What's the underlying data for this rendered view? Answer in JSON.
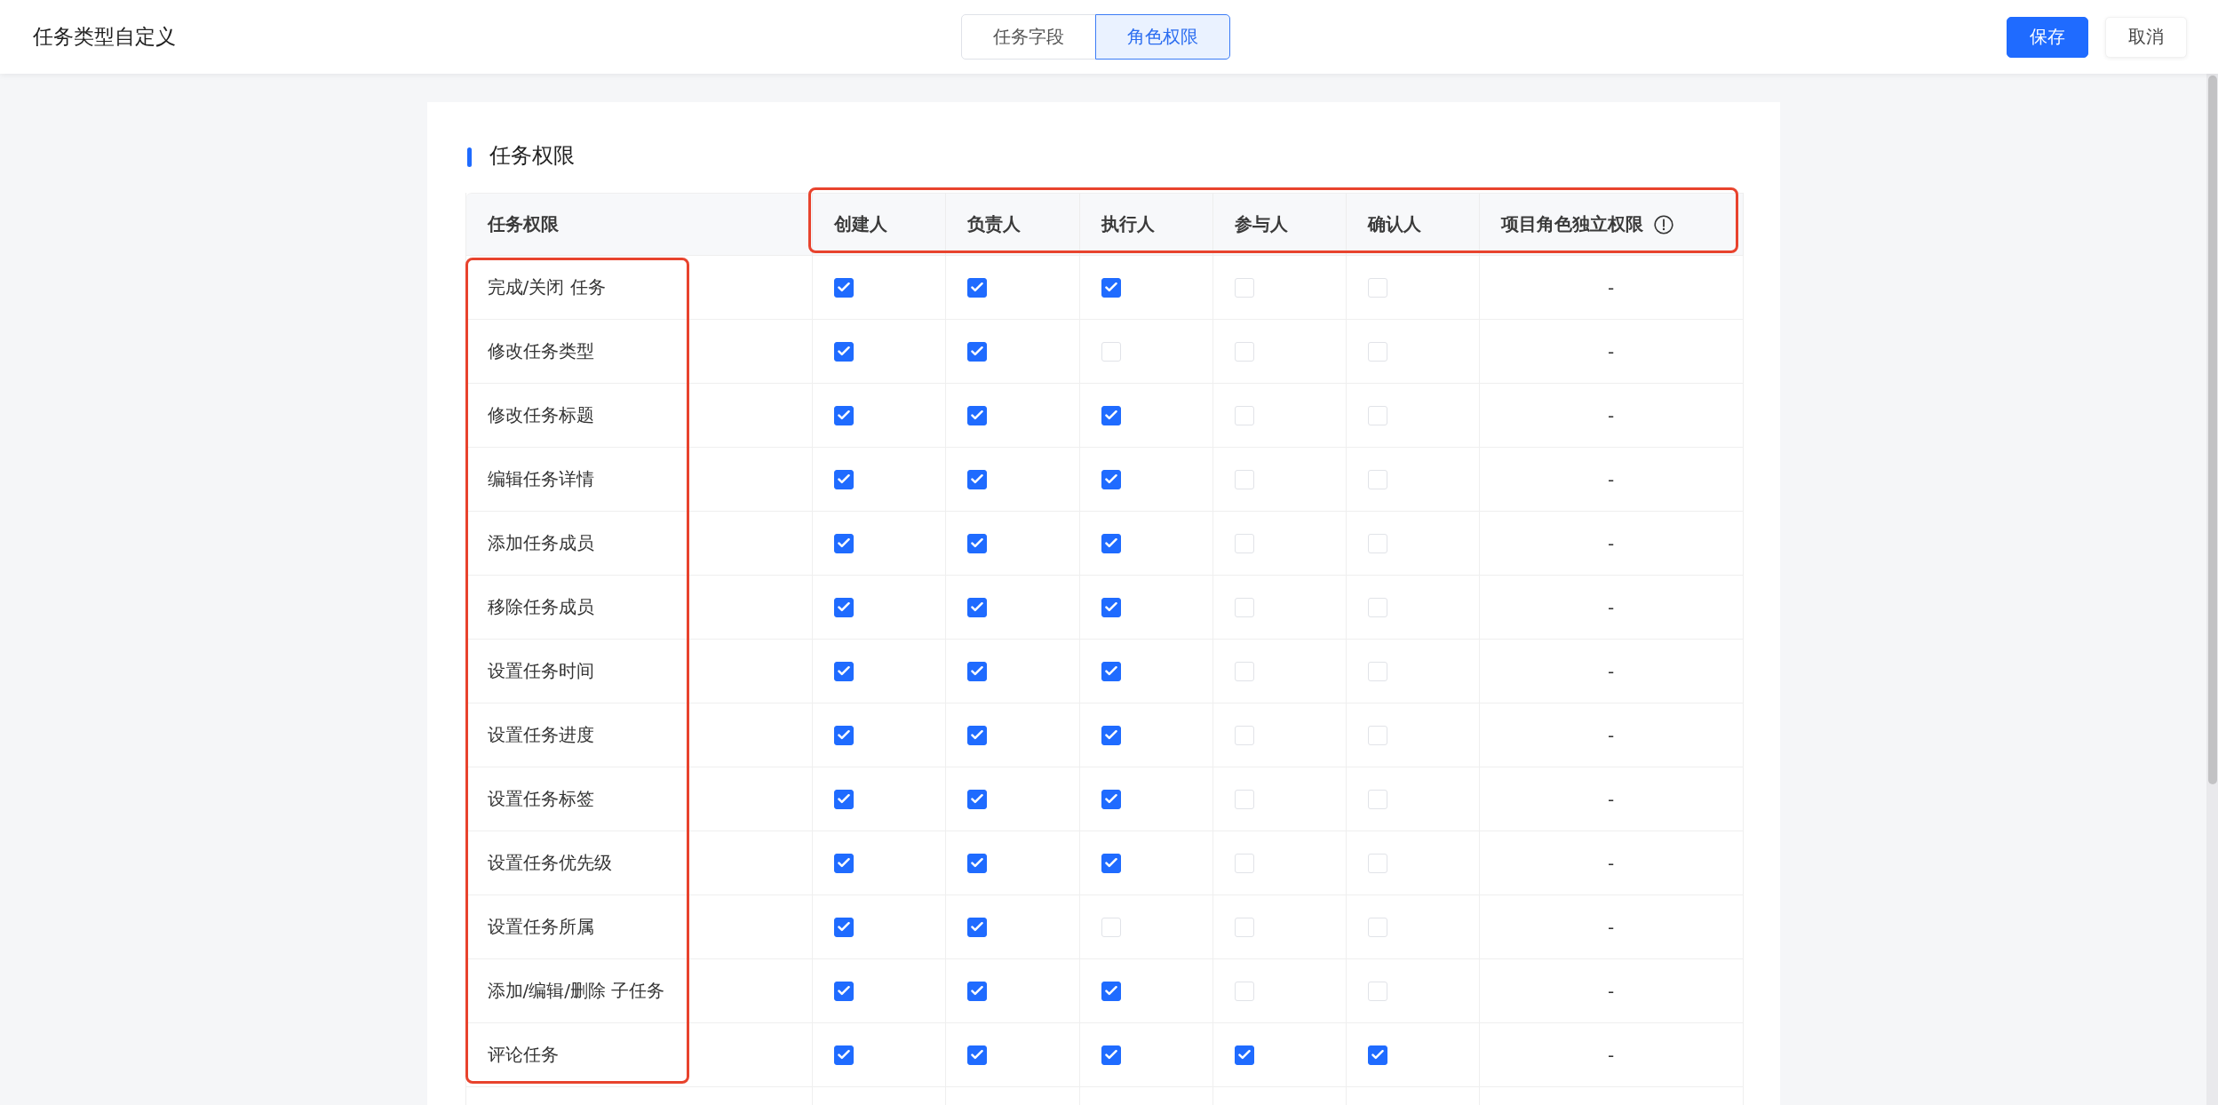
{
  "header": {
    "title": "任务类型自定义",
    "tabs": [
      {
        "label": "任务字段",
        "selected": false
      },
      {
        "label": "角色权限",
        "selected": true
      }
    ],
    "buttons": [
      {
        "label": "保存",
        "kind": "primary"
      },
      {
        "label": "取消",
        "kind": "default"
      }
    ]
  },
  "section": {
    "title": "任务权限"
  },
  "table": {
    "role_headers_framed": true,
    "permission_names_framed": true,
    "columns": [
      {
        "label": "任务权限",
        "info": false
      },
      {
        "label": "创建人",
        "info": false
      },
      {
        "label": "负责人",
        "info": false
      },
      {
        "label": "执行人",
        "info": false
      },
      {
        "label": "参与人",
        "info": false
      },
      {
        "label": "确认人",
        "info": false
      },
      {
        "label": "项目角色独立权限",
        "info": true
      }
    ],
    "rows": [
      {
        "name": "完成/关闭 任务",
        "checks": [
          true,
          true,
          true,
          false,
          false
        ],
        "independent": "-"
      },
      {
        "name": "修改任务类型",
        "checks": [
          true,
          true,
          false,
          false,
          false
        ],
        "independent": "-"
      },
      {
        "name": "修改任务标题",
        "checks": [
          true,
          true,
          true,
          false,
          false
        ],
        "independent": "-"
      },
      {
        "name": "编辑任务详情",
        "checks": [
          true,
          true,
          true,
          false,
          false
        ],
        "independent": "-"
      },
      {
        "name": "添加任务成员",
        "checks": [
          true,
          true,
          true,
          false,
          false
        ],
        "independent": "-"
      },
      {
        "name": "移除任务成员",
        "checks": [
          true,
          true,
          true,
          false,
          false
        ],
        "independent": "-"
      },
      {
        "name": "设置任务时间",
        "checks": [
          true,
          true,
          true,
          false,
          false
        ],
        "independent": "-"
      },
      {
        "name": "设置任务进度",
        "checks": [
          true,
          true,
          true,
          false,
          false
        ],
        "independent": "-"
      },
      {
        "name": "设置任务标签",
        "checks": [
          true,
          true,
          true,
          false,
          false
        ],
        "independent": "-"
      },
      {
        "name": "设置任务优先级",
        "checks": [
          true,
          true,
          true,
          false,
          false
        ],
        "independent": "-"
      },
      {
        "name": "设置任务所属",
        "checks": [
          true,
          true,
          false,
          false,
          false
        ],
        "independent": "-"
      },
      {
        "name": "添加/编辑/删除 子任务",
        "checks": [
          true,
          true,
          true,
          false,
          false
        ],
        "independent": "-"
      },
      {
        "name": "评论任务",
        "checks": [
          true,
          true,
          true,
          true,
          true
        ],
        "independent": "-"
      }
    ]
  }
}
